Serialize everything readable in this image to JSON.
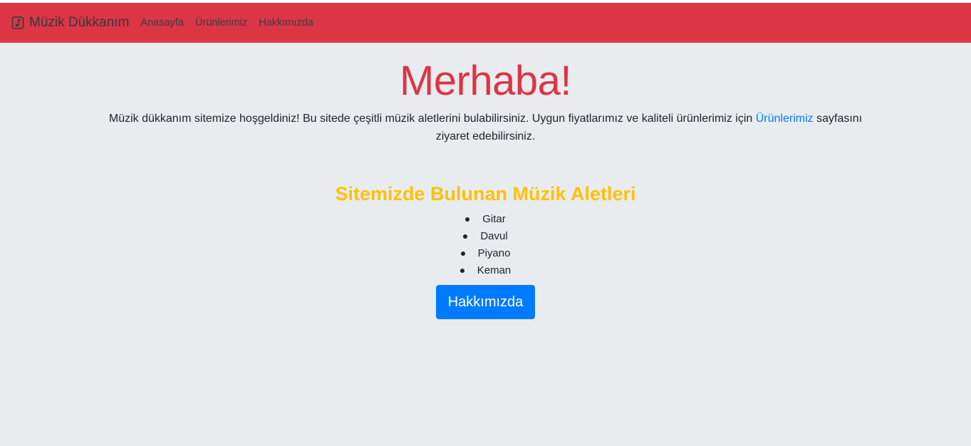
{
  "navbar": {
    "brand": "Müzik Dükkanım",
    "brand_icon": "music-note-icon",
    "links": [
      "Anasayfa",
      "Ürünlerimiz",
      "Hakkımızda"
    ],
    "background": "#dc3545"
  },
  "hero": {
    "title": "Merhaba!",
    "text_before": "Müzik dükkanım sitemize hoşgeldiniz! Bu sitede çeşitli müzik aletlerini bulabilirsiniz. Uygun fiyatlarımız ve kaliteli ürünlerimiz için ",
    "link": "Ürünlerimiz",
    "text_after": " sayfasını ziyaret edebilirsiniz."
  },
  "instruments": {
    "title": "Sitemizde Bulunan Müzik Aletleri",
    "items": [
      "Gitar",
      "Davul",
      "Piyano",
      "Keman"
    ]
  },
  "about_button": {
    "label": "Hakkımızda"
  },
  "colors": {
    "accent_red": "#dc3545",
    "accent_yellow": "#ffc107",
    "link_blue": "#007bff",
    "page_bg": "#e9ecef"
  }
}
